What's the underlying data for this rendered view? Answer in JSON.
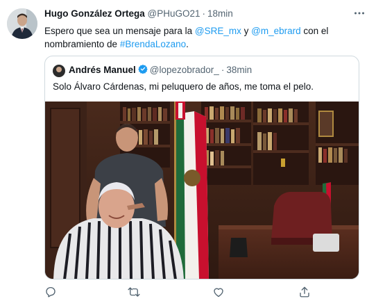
{
  "tweet": {
    "author_name": "Hugo González Ortega",
    "handle": "@PHuGO21",
    "separator": "·",
    "time": "18min",
    "more_icon": "more-horizontal-icon",
    "text_before": "Espero que sea un mensaje para la ",
    "mention_1": "@SRE_mx",
    "text_and": " y ",
    "mention_2": "@m_ebrard",
    "text_mid": " con el nombramiento de ",
    "hashtag": "#BrendaLozano",
    "text_end": "."
  },
  "quote": {
    "author_name": "Andrés Manuel",
    "verified_icon": "verified-badge-icon",
    "handle": "@lopezobrador_",
    "separator": "·",
    "time": "38min",
    "text": "Solo Álvaro Cárdenas, mi peluquero de años, me toma el pelo."
  },
  "actions": {
    "icons": [
      "reply-icon",
      "retweet-icon",
      "like-icon",
      "share-icon"
    ]
  },
  "colors": {
    "link": "#1d9bf0",
    "muted": "#536471",
    "border": "#cfd9de",
    "verified": "#1d9bf0"
  }
}
